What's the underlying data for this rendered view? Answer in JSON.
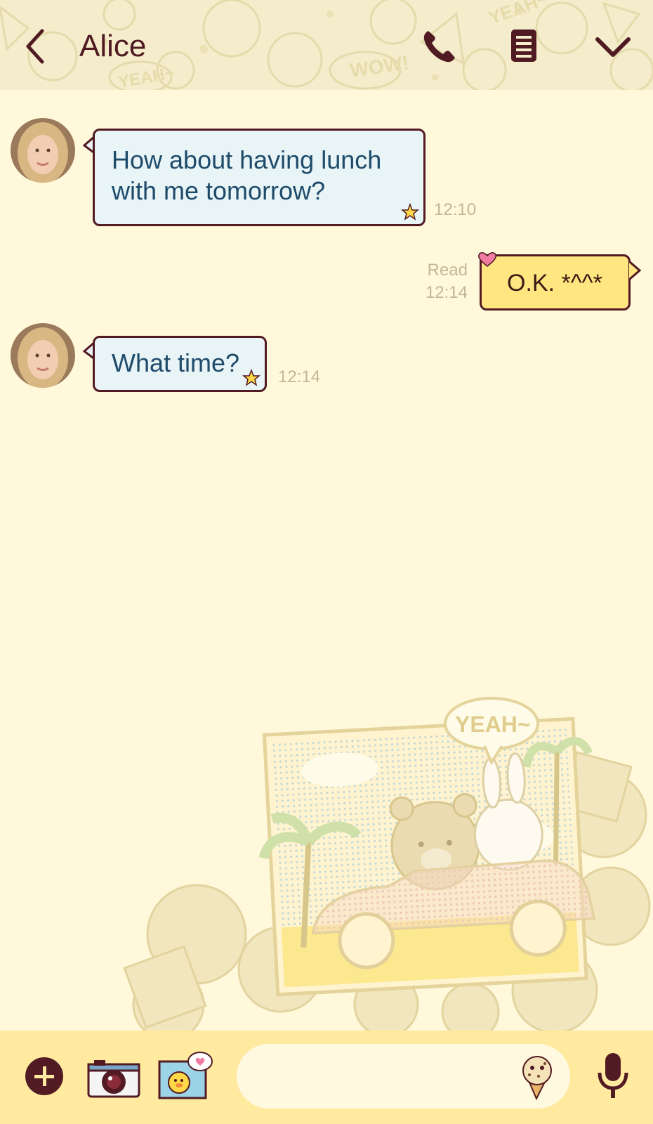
{
  "header": {
    "title": "Alice",
    "back_icon": "chevron-left-icon",
    "call_icon": "phone-icon",
    "menu_icon": "notes-icon",
    "collapse_icon": "chevron-down-icon"
  },
  "messages": [
    {
      "from": "Alice",
      "direction": "incoming",
      "text_line1": "How about having lunch",
      "text_line2": "with me tomorrow?",
      "time": "12:10"
    },
    {
      "from": "me",
      "direction": "outgoing",
      "text": "O.K. *^^*",
      "status": "Read",
      "time": "12:14"
    },
    {
      "from": "Alice",
      "direction": "incoming",
      "text": "What time?",
      "time": "12:14"
    }
  ],
  "background_art": {
    "speech_text": "YEAH~"
  },
  "input": {
    "placeholder": ""
  },
  "colors": {
    "background": "#fff8db",
    "header": "#f4eccb",
    "accent_dark": "#521a22",
    "incoming_bubble": "#e8f4f6",
    "outgoing_bubble": "#ffe680",
    "timestamp": "#c2b795",
    "bottom_bar": "#ffeaa0"
  }
}
